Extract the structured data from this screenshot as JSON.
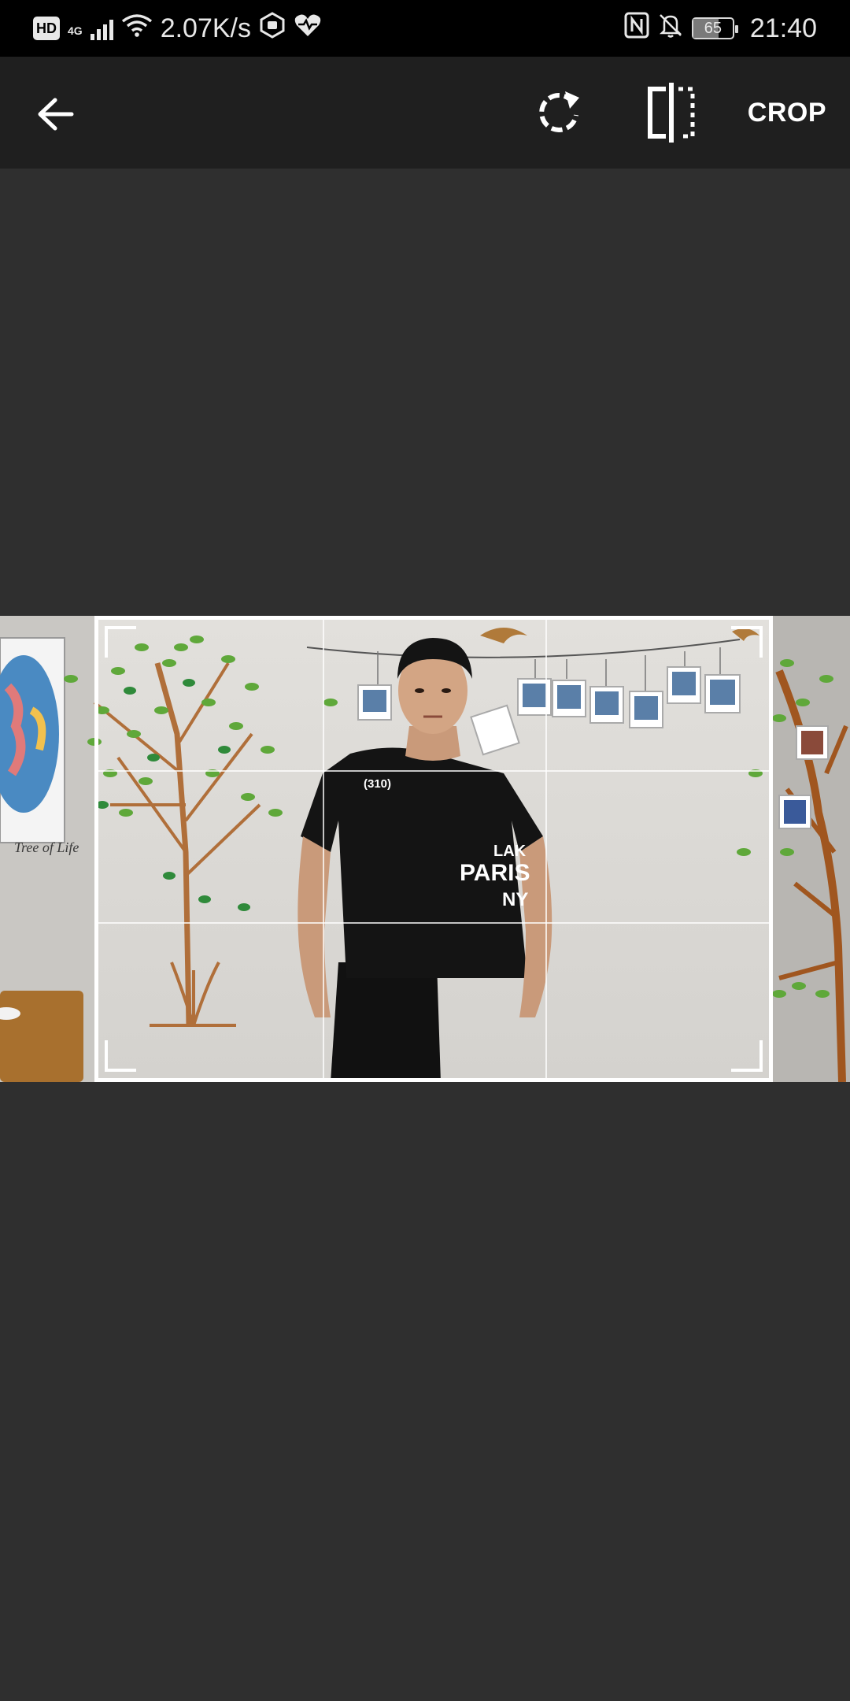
{
  "status_bar": {
    "hd_badge": "HD",
    "network_type": "4G",
    "net_speed": "2.07K/s",
    "battery_level": "65",
    "time": "21:40",
    "icons": [
      "signal-icon",
      "wifi-icon",
      "vpn-icon",
      "health-heart-icon",
      "nfc-icon",
      "bell-off-icon",
      "battery-icon"
    ]
  },
  "toolbar": {
    "back_icon": "arrow-left-icon",
    "rotate_icon": "rotate-icon",
    "flip_icon": "flip-horizontal-icon",
    "crop_label": "CROP"
  },
  "photo": {
    "shirt_text_1": "(310)",
    "shirt_text_2": "LAK",
    "shirt_text_3": "PARIS",
    "shirt_text_4": "NY",
    "wall_text": "Tree of Life"
  },
  "colors": {
    "toolbar_bg": "#1f1f1f",
    "editor_bg": "#2f2f2f",
    "crop_frame": "#ffffff"
  }
}
